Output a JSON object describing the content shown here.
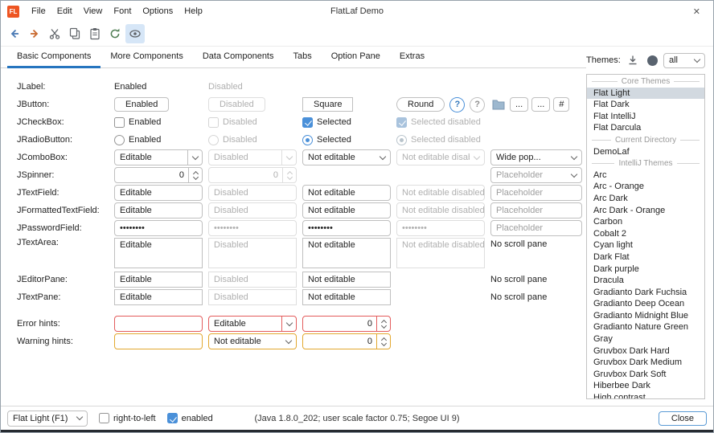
{
  "colors": {
    "accent": "#2675bf",
    "selection_blue": "#4a90d9",
    "error_border": "#e35c5c",
    "warning_border": "#e3a82f",
    "logo_bg": "#ee5522",
    "window_border": "#98a2ac",
    "bottom_edge": "#262b31"
  },
  "titlebar": {
    "logo_text": "FL",
    "menus": [
      "File",
      "Edit",
      "View",
      "Font",
      "Options",
      "Help"
    ],
    "title": "FlatLaf Demo",
    "close_glyph": "✕"
  },
  "toolbar": {
    "buttons": [
      "back",
      "forward",
      "cut",
      "copy",
      "paste",
      "refresh",
      "show-hidden"
    ]
  },
  "tabs": {
    "items": [
      "Basic Components",
      "More Components",
      "Data Components",
      "Tabs",
      "Option Pane",
      "Extras"
    ],
    "selected": "Basic Components"
  },
  "grid": {
    "jlabel": {
      "label": "JLabel:",
      "enabled": "Enabled",
      "disabled": "Disabled"
    },
    "jbutton": {
      "label": "JButton:",
      "enabled": "Enabled",
      "disabled": "Disabled",
      "square": "Square",
      "round": "Round",
      "help": "?",
      "ellipsis": "...",
      "hash": "#"
    },
    "jcheckbox": {
      "label": "JCheckBox:",
      "enabled": "Enabled",
      "disabled": "Disabled",
      "selected": "Selected",
      "selected_disabled": "Selected disabled"
    },
    "jradiobutton": {
      "label": "JRadioButton:",
      "enabled": "Enabled",
      "disabled": "Disabled",
      "selected": "Selected",
      "selected_disabled": "Selected disabled"
    },
    "jcombobox": {
      "label": "JComboBox:",
      "editable": "Editable",
      "disabled": "Disabled",
      "not_editable": "Not editable",
      "not_editable_disabled": "Not editable disabled",
      "wide": "Wide pop..."
    },
    "jspinner": {
      "label": "JSpinner:",
      "value": "0",
      "value_disabled": "0",
      "placeholder": "Placeholder"
    },
    "jtextfield": {
      "label": "JTextField:",
      "editable": "Editable",
      "disabled": "Disabled",
      "not_editable": "Not editable",
      "not_editable_disabled": "Not editable disabled",
      "placeholder": "Placeholder"
    },
    "jformattedtextfield": {
      "label": "JFormattedTextField:",
      "editable": "Editable",
      "disabled": "Disabled",
      "not_editable": "Not editable",
      "not_editable_disabled": "Not editable disabled",
      "placeholder": "Placeholder"
    },
    "jpasswordfield": {
      "label": "JPasswordField:",
      "password": "••••••••",
      "placeholder": "Placeholder"
    },
    "jtextarea": {
      "label": "JTextArea:",
      "editable": "Editable",
      "disabled": "Disabled",
      "not_editable": "Not editable",
      "not_editable_disabled": "Not editable disabled",
      "no_scroll": "No scroll pane"
    },
    "jeditorpane": {
      "label": "JEditorPane:",
      "editable": "Editable",
      "disabled": "Disabled",
      "not_editable": "Not editable",
      "no_scroll": "No scroll pane"
    },
    "jtextpane": {
      "label": "JTextPane:",
      "editable": "Editable",
      "disabled": "Disabled",
      "not_editable": "Not editable",
      "no_scroll": "No scroll pane"
    },
    "error_hints": {
      "label": "Error hints:",
      "field": "",
      "combo": "Editable",
      "spinner": "0"
    },
    "warning_hints": {
      "label": "Warning hints:",
      "field": "",
      "combo": "Not editable",
      "spinner": "0"
    }
  },
  "themes": {
    "label": "Themes:",
    "filter_value": "all",
    "items": [
      {
        "type": "separator",
        "label": "Core Themes"
      },
      {
        "type": "item",
        "label": "Flat Light",
        "selected": true
      },
      {
        "type": "item",
        "label": "Flat Dark"
      },
      {
        "type": "item",
        "label": "Flat IntelliJ"
      },
      {
        "type": "item",
        "label": "Flat Darcula"
      },
      {
        "type": "separator",
        "label": "Current Directory"
      },
      {
        "type": "item",
        "label": "DemoLaf"
      },
      {
        "type": "separator",
        "label": "IntelliJ Themes"
      },
      {
        "type": "item",
        "label": "Arc"
      },
      {
        "type": "item",
        "label": "Arc - Orange"
      },
      {
        "type": "item",
        "label": "Arc Dark"
      },
      {
        "type": "item",
        "label": "Arc Dark - Orange"
      },
      {
        "type": "item",
        "label": "Carbon"
      },
      {
        "type": "item",
        "label": "Cobalt 2"
      },
      {
        "type": "item",
        "label": "Cyan light"
      },
      {
        "type": "item",
        "label": "Dark Flat"
      },
      {
        "type": "item",
        "label": "Dark purple"
      },
      {
        "type": "item",
        "label": "Dracula"
      },
      {
        "type": "item",
        "label": "Gradianto Dark Fuchsia"
      },
      {
        "type": "item",
        "label": "Gradianto Deep Ocean"
      },
      {
        "type": "item",
        "label": "Gradianto Midnight Blue"
      },
      {
        "type": "item",
        "label": "Gradianto Nature Green"
      },
      {
        "type": "item",
        "label": "Gray"
      },
      {
        "type": "item",
        "label": "Gruvbox Dark Hard"
      },
      {
        "type": "item",
        "label": "Gruvbox Dark Medium"
      },
      {
        "type": "item",
        "label": "Gruvbox Dark Soft"
      },
      {
        "type": "item",
        "label": "Hiberbee Dark"
      },
      {
        "type": "item",
        "label": "High contrast"
      }
    ]
  },
  "statusbar": {
    "lookandfeel": "Flat Light (F1)",
    "rtl": "right-to-left",
    "enabled": "enabled",
    "info": "(Java 1.8.0_202;  user scale factor 0.75;  Segoe UI 9)",
    "close": "Close"
  }
}
